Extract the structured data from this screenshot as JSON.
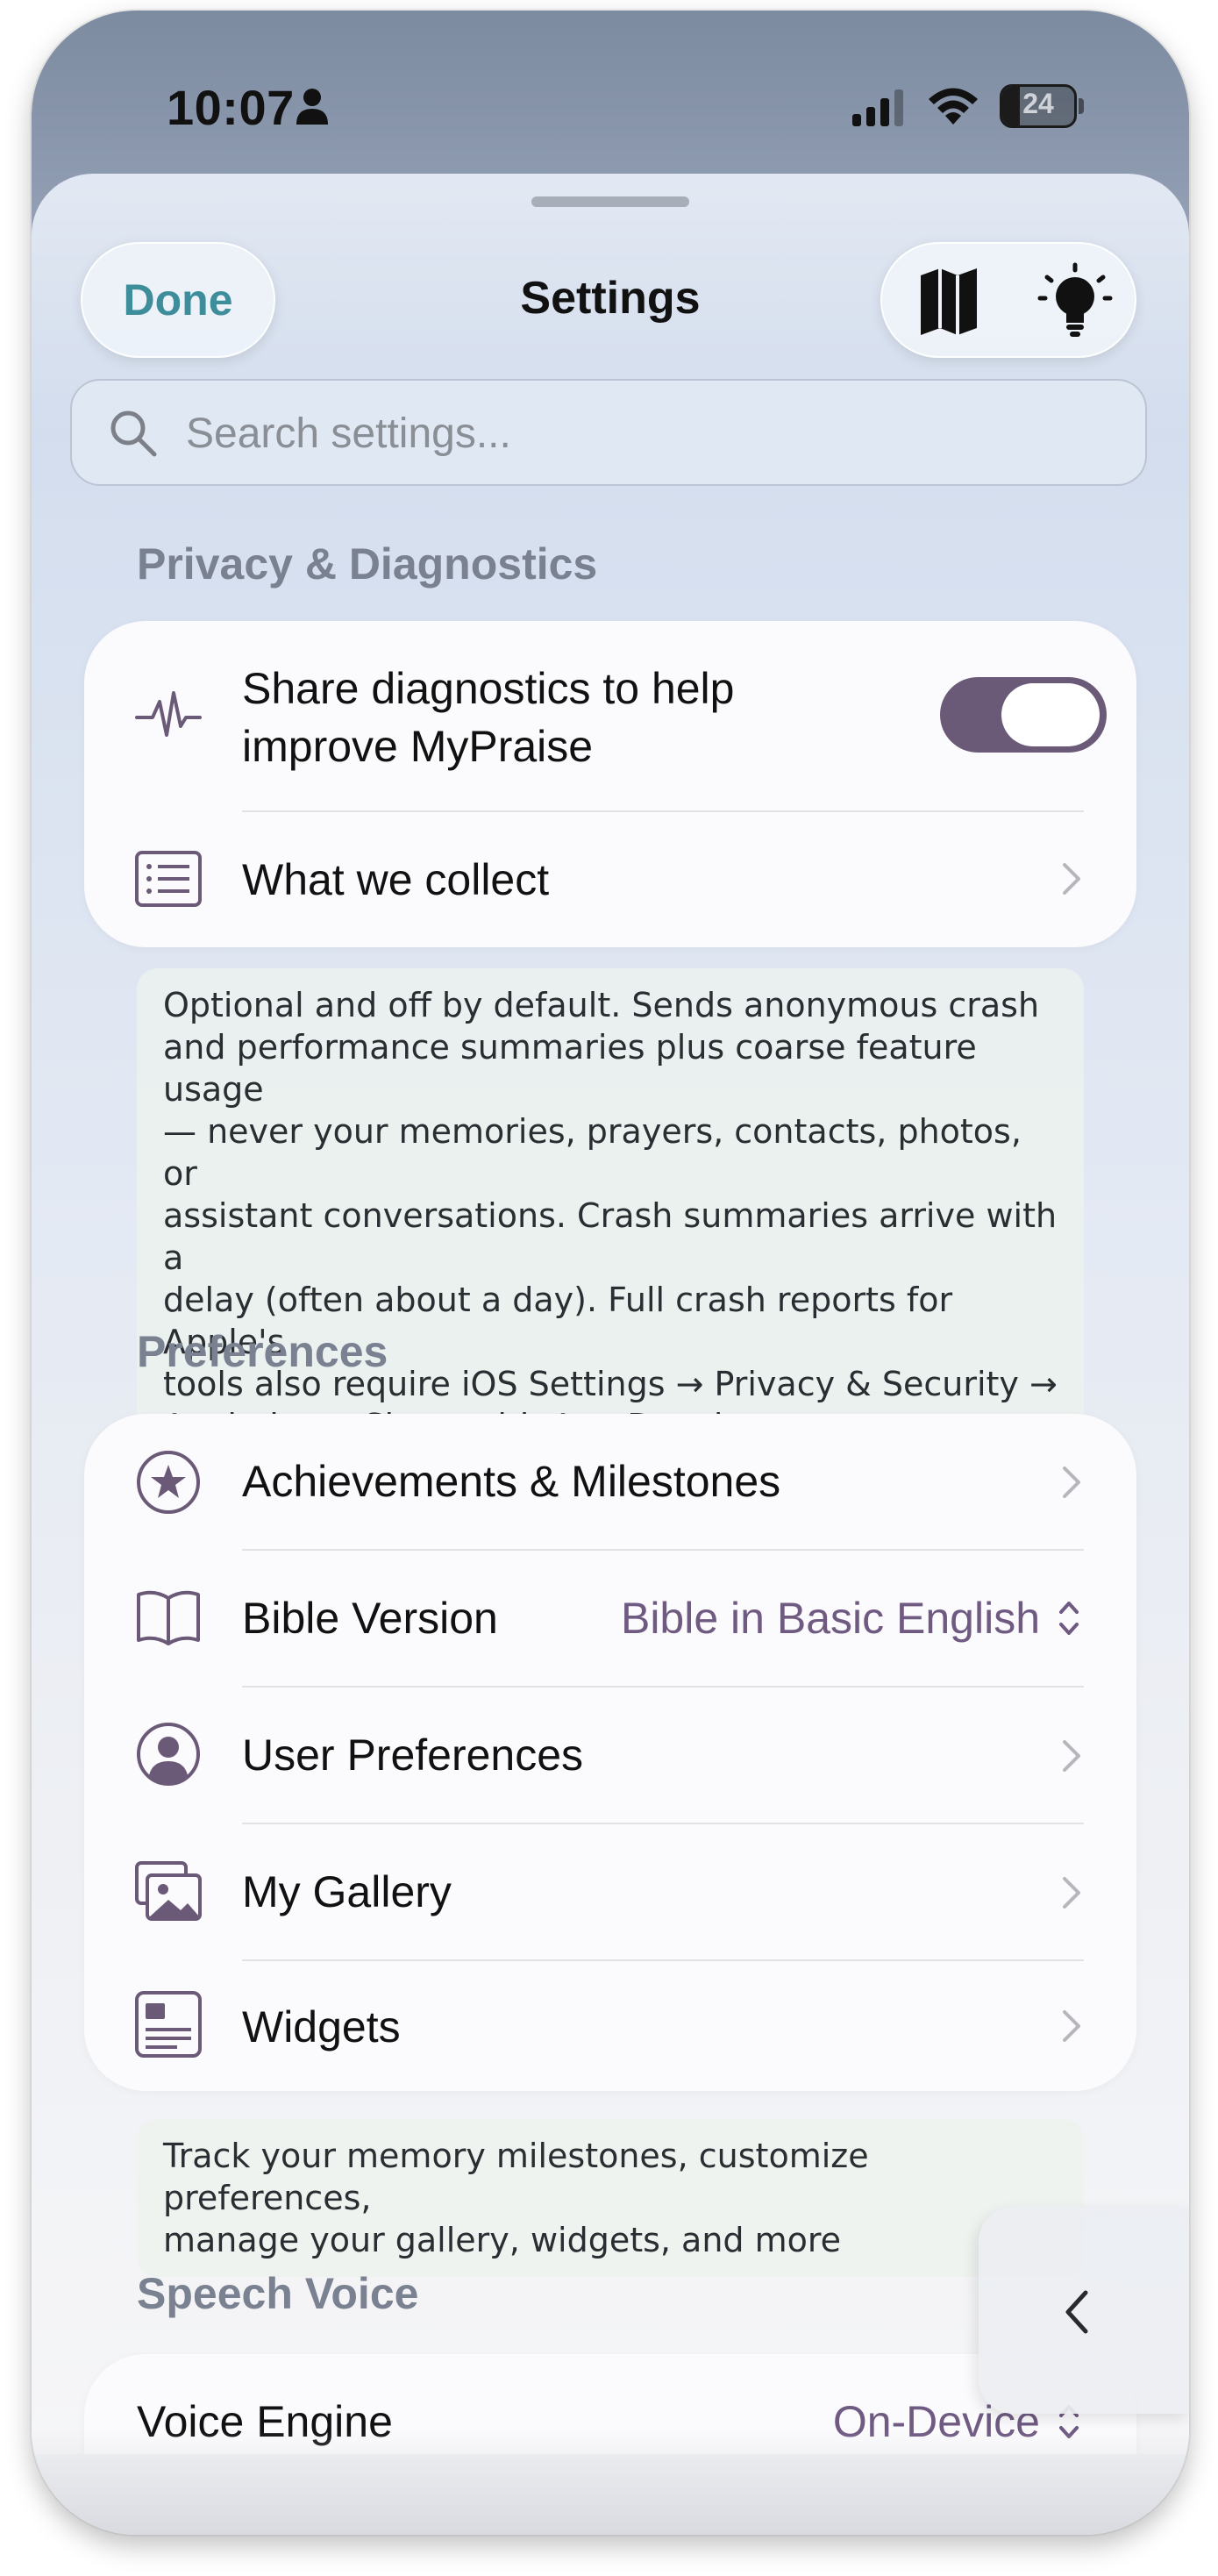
{
  "status_bar": {
    "time": "10:07",
    "battery_level": "24",
    "battery_fraction": 0.24
  },
  "nav": {
    "done_label": "Done",
    "title": "Settings"
  },
  "search": {
    "placeholder": "Search settings..."
  },
  "privacy": {
    "header": "Privacy & Diagnostics",
    "share_label_line1": "Share diagnostics to help",
    "share_label_line2": "improve MyPraise",
    "share_enabled": true,
    "collect_label": "What we collect",
    "footnote_lines": [
      "Optional and off by default. Sends anonymous crash",
      "and performance summaries plus coarse feature usage",
      "— never your memories, prayers, contacts, photos, or",
      "assistant conversations. Crash summaries arrive with a",
      "delay (often about a day). Full crash reports for Apple's",
      "tools also require iOS Settings → Privacy & Security →",
      "Analytics → Share with App Developers."
    ]
  },
  "preferences": {
    "header": "Preferences",
    "items": [
      {
        "label": "Achievements & Milestones",
        "icon": "star-circle-icon"
      },
      {
        "label": "Bible Version",
        "icon": "book-icon",
        "value": "Bible in Basic English"
      },
      {
        "label": "User Preferences",
        "icon": "person-circle-icon"
      },
      {
        "label": "My Gallery",
        "icon": "photos-icon"
      },
      {
        "label": "Widgets",
        "icon": "widget-icon"
      }
    ],
    "footnote_lines": [
      "Track your memory milestones, customize preferences,",
      "manage your gallery, widgets, and more"
    ]
  },
  "speech": {
    "header": "Speech Voice",
    "voice_engine_label": "Voice Engine",
    "voice_engine_value": "On-Device"
  },
  "colors": {
    "accent": "#6a5a77",
    "done_text": "#3d8d9a",
    "value_text": "#6f5a82"
  }
}
